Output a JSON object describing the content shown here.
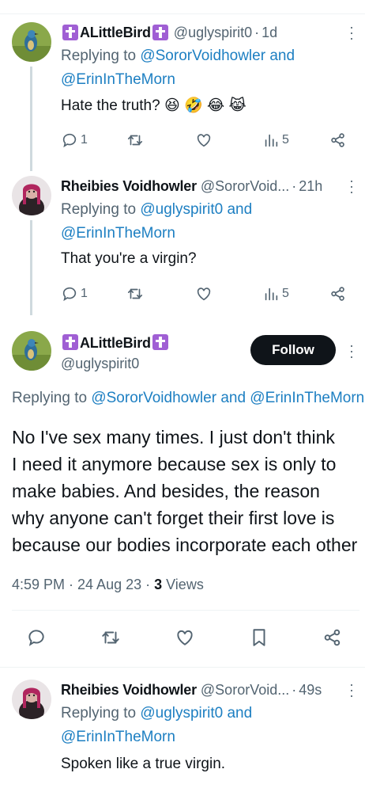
{
  "tweets": [
    {
      "name": "ALittleBird",
      "handle": "@uglyspirit0",
      "time": "1d",
      "replying_prefix": "Replying to ",
      "replying_line1": "@SororVoidhowler and",
      "replying_line2": "@ErinInTheMorn",
      "text": "Hate the truth? 😆 🤣 😂 😹",
      "replies": "1",
      "views": "5"
    },
    {
      "name": "Rheibies Voidhowler",
      "handle": "@SororVoid...",
      "time": "21h",
      "replying_prefix": "Replying to ",
      "replying_line1": "@uglyspirit0 and",
      "replying_line2": "@ErinInTheMorn",
      "text": "That you're a virgin?",
      "replies": "1",
      "views": "5"
    }
  ],
  "main": {
    "name": "ALittleBird",
    "handle": "@uglyspirit0",
    "follow_label": "Follow",
    "replying_prefix": "Replying to ",
    "replying_to": "@SororVoidhowler and @ErinInTheMorn",
    "text_lines": [
      "No I've sex many times. I just don't think",
      "I need it anymore because sex is only to",
      "make babies. And besides, the reason",
      "why anyone can't forget their first love is",
      "because our bodies incorporate each other"
    ],
    "timestamp": "4:59 PM · 24 Aug 23 · ",
    "views_count": "3",
    "views_label": " Views"
  },
  "last_reply": {
    "name": "Rheibies Voidhowler",
    "handle": "@SororVoid...",
    "time": "49s",
    "replying_prefix": "Replying to ",
    "replying_line1": "@uglyspirit0 and",
    "replying_line2": "@ErinInTheMorn",
    "text": "Spoken like a true virgin."
  },
  "colors": {
    "link": "#1d7fc2",
    "muted": "#536471",
    "follow_bg": "#0f1419",
    "cross_badge": "#a05fd4"
  },
  "icons": [
    "reply-icon",
    "retweet-icon",
    "like-icon",
    "views-icon",
    "share-icon",
    "bookmark-icon",
    "more-icon",
    "cross-emoji-icon"
  ]
}
